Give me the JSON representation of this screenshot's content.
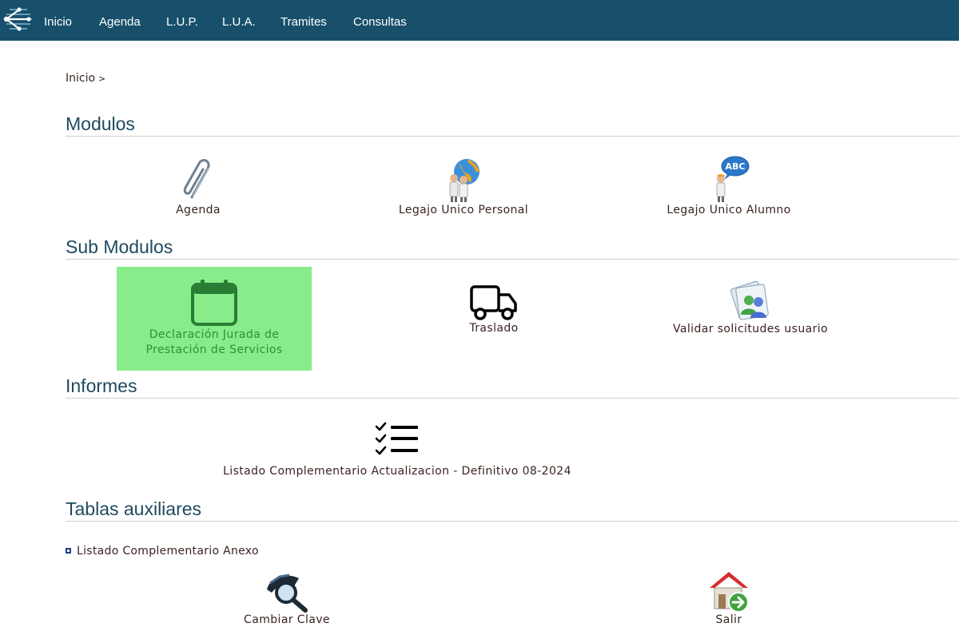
{
  "nav": {
    "items": [
      "Inicio",
      "Agenda",
      "L.U.P.",
      "L.U.A.",
      "Tramites",
      "Consultas"
    ]
  },
  "breadcrumb": {
    "home": "Inicio",
    "separator": ">"
  },
  "sections": {
    "modulos": "Modulos",
    "sub_modulos": "Sub Modulos",
    "informes": "Informes",
    "tablas": "Tablas auxiliares"
  },
  "modulos": [
    {
      "label": "Agenda",
      "icon": "paperclip-icon"
    },
    {
      "label": "Legajo Unico Personal",
      "icon": "globe-people-icon"
    },
    {
      "label": "Legajo Unico Alumno",
      "icon": "person-speech-icon"
    }
  ],
  "sub_modulos": [
    {
      "label": "Declaración Jurada de Prestación de Servicios",
      "icon": "calendar-icon",
      "highlighted": true
    },
    {
      "label": "Traslado",
      "icon": "truck-icon"
    },
    {
      "label": "Validar solicitudes usuario",
      "icon": "users-icon"
    }
  ],
  "informes": [
    {
      "label": "Listado Complementario Actualizacion - Definitivo 08-2024",
      "icon": "checklist-icon"
    }
  ],
  "tablas": {
    "link": "Listado Complementario Anexo",
    "items": [
      {
        "label": "Cambiar Clave",
        "icon": "magnifier-icon"
      },
      {
        "label": "Salir",
        "icon": "home-exit-icon"
      }
    ]
  },
  "colors": {
    "nav_bg": "#18506b",
    "highlight_bg": "#88ec8b",
    "heading": "#1e4a5e"
  }
}
